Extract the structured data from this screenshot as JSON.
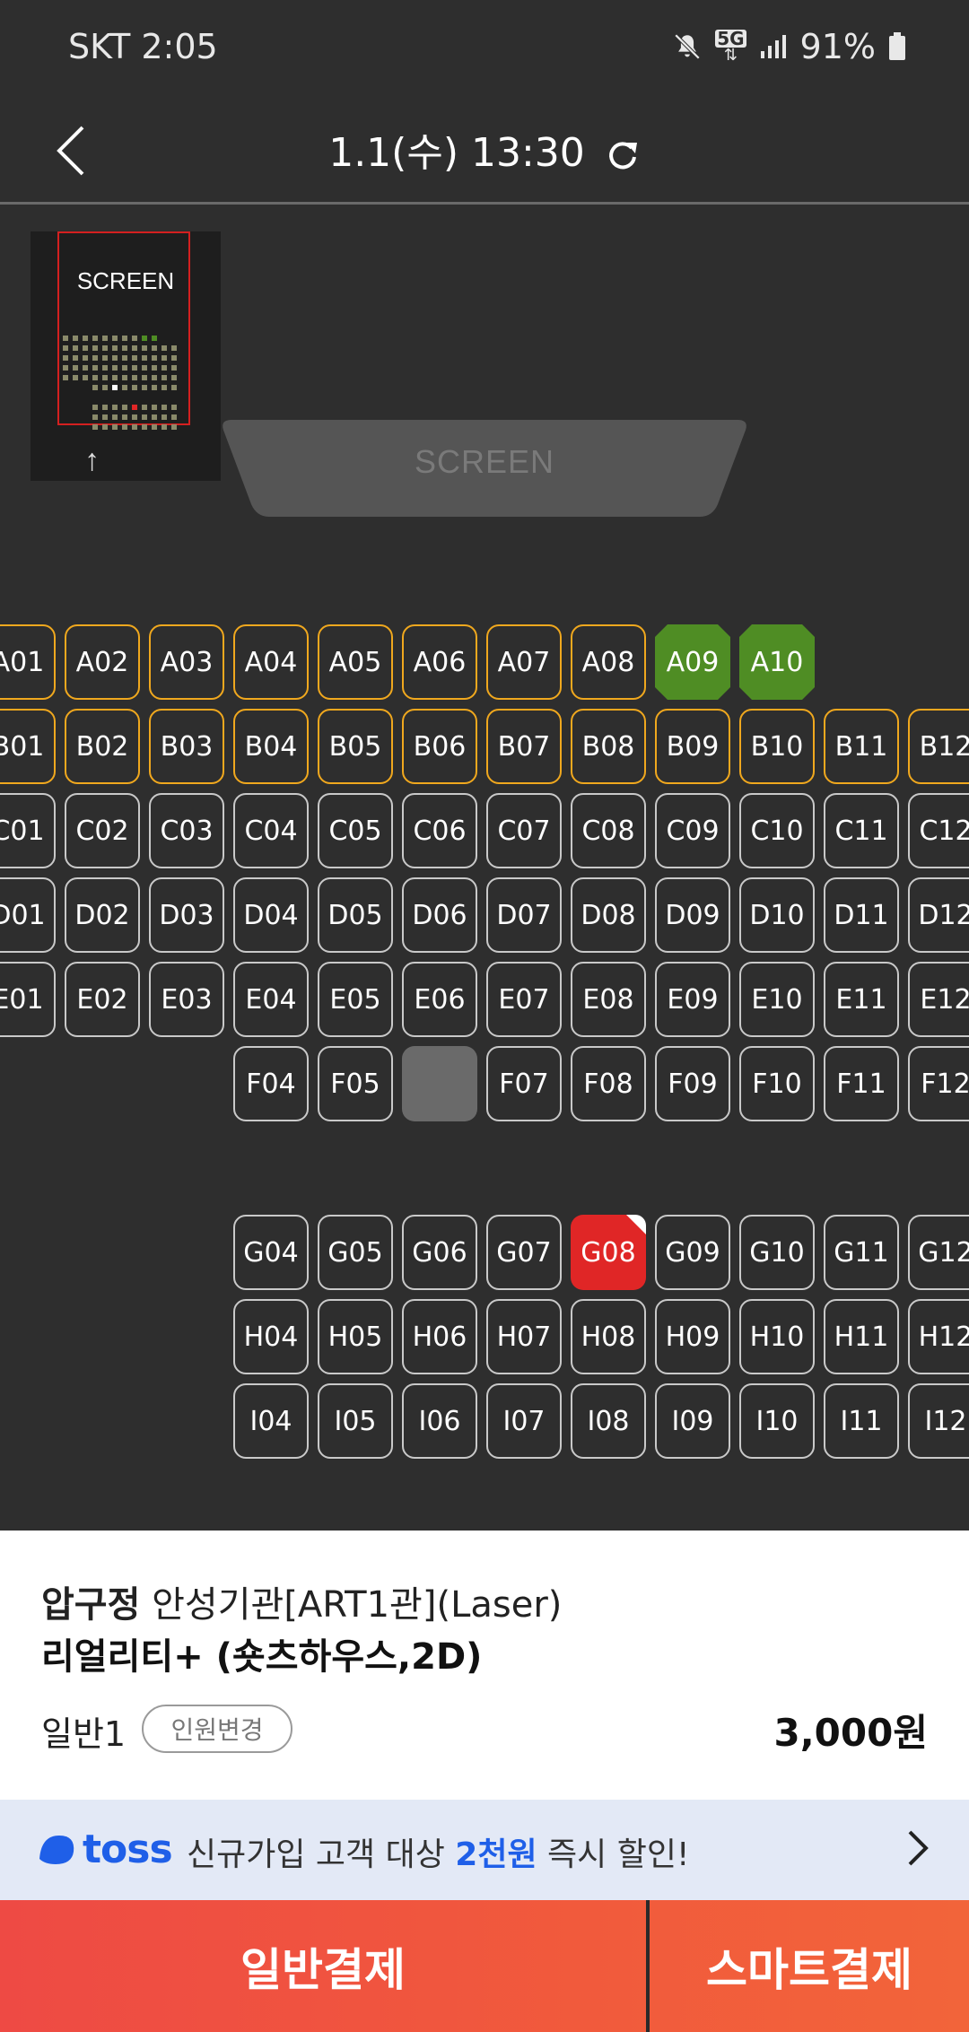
{
  "status_bar": {
    "carrier_time": "SKT 2:05",
    "network": "5G",
    "battery": "91%"
  },
  "header": {
    "title": "1.1(수) 13:30"
  },
  "minimap": {
    "screen_label": "SCREEN"
  },
  "screen": {
    "label": "SCREEN"
  },
  "seats": [
    {
      "id": "A01",
      "row": 0,
      "col": 0,
      "status": "premium"
    },
    {
      "id": "A02",
      "row": 0,
      "col": 1,
      "status": "premium"
    },
    {
      "id": "A03",
      "row": 0,
      "col": 2,
      "status": "premium"
    },
    {
      "id": "A04",
      "row": 0,
      "col": 3,
      "status": "premium"
    },
    {
      "id": "A05",
      "row": 0,
      "col": 4,
      "status": "premium"
    },
    {
      "id": "A06",
      "row": 0,
      "col": 5,
      "status": "premium"
    },
    {
      "id": "A07",
      "row": 0,
      "col": 6,
      "status": "premium"
    },
    {
      "id": "A08",
      "row": 0,
      "col": 7,
      "status": "premium"
    },
    {
      "id": "A09",
      "row": 0,
      "col": 8,
      "status": "selected-green"
    },
    {
      "id": "A10",
      "row": 0,
      "col": 9,
      "status": "selected-green"
    },
    {
      "id": "B01",
      "row": 1,
      "col": 0,
      "status": "premium"
    },
    {
      "id": "B02",
      "row": 1,
      "col": 1,
      "status": "premium"
    },
    {
      "id": "B03",
      "row": 1,
      "col": 2,
      "status": "premium"
    },
    {
      "id": "B04",
      "row": 1,
      "col": 3,
      "status": "premium"
    },
    {
      "id": "B05",
      "row": 1,
      "col": 4,
      "status": "premium"
    },
    {
      "id": "B06",
      "row": 1,
      "col": 5,
      "status": "premium"
    },
    {
      "id": "B07",
      "row": 1,
      "col": 6,
      "status": "premium"
    },
    {
      "id": "B08",
      "row": 1,
      "col": 7,
      "status": "premium"
    },
    {
      "id": "B09",
      "row": 1,
      "col": 8,
      "status": "premium"
    },
    {
      "id": "B10",
      "row": 1,
      "col": 9,
      "status": "premium"
    },
    {
      "id": "B11",
      "row": 1,
      "col": 10,
      "status": "premium"
    },
    {
      "id": "B12",
      "row": 1,
      "col": 11,
      "status": "premium"
    },
    {
      "id": "C01",
      "row": 2,
      "col": 0,
      "status": "normal"
    },
    {
      "id": "C02",
      "row": 2,
      "col": 1,
      "status": "normal"
    },
    {
      "id": "C03",
      "row": 2,
      "col": 2,
      "status": "normal"
    },
    {
      "id": "C04",
      "row": 2,
      "col": 3,
      "status": "normal"
    },
    {
      "id": "C05",
      "row": 2,
      "col": 4,
      "status": "normal"
    },
    {
      "id": "C06",
      "row": 2,
      "col": 5,
      "status": "normal"
    },
    {
      "id": "C07",
      "row": 2,
      "col": 6,
      "status": "normal"
    },
    {
      "id": "C08",
      "row": 2,
      "col": 7,
      "status": "normal"
    },
    {
      "id": "C09",
      "row": 2,
      "col": 8,
      "status": "normal"
    },
    {
      "id": "C10",
      "row": 2,
      "col": 9,
      "status": "normal"
    },
    {
      "id": "C11",
      "row": 2,
      "col": 10,
      "status": "normal"
    },
    {
      "id": "C12",
      "row": 2,
      "col": 11,
      "status": "normal"
    },
    {
      "id": "D01",
      "row": 3,
      "col": 0,
      "status": "normal"
    },
    {
      "id": "D02",
      "row": 3,
      "col": 1,
      "status": "normal"
    },
    {
      "id": "D03",
      "row": 3,
      "col": 2,
      "status": "normal"
    },
    {
      "id": "D04",
      "row": 3,
      "col": 3,
      "status": "normal"
    },
    {
      "id": "D05",
      "row": 3,
      "col": 4,
      "status": "normal"
    },
    {
      "id": "D06",
      "row": 3,
      "col": 5,
      "status": "normal"
    },
    {
      "id": "D07",
      "row": 3,
      "col": 6,
      "status": "normal"
    },
    {
      "id": "D08",
      "row": 3,
      "col": 7,
      "status": "normal"
    },
    {
      "id": "D09",
      "row": 3,
      "col": 8,
      "status": "normal"
    },
    {
      "id": "D10",
      "row": 3,
      "col": 9,
      "status": "normal"
    },
    {
      "id": "D11",
      "row": 3,
      "col": 10,
      "status": "normal"
    },
    {
      "id": "D12",
      "row": 3,
      "col": 11,
      "status": "normal"
    },
    {
      "id": "E01",
      "row": 4,
      "col": 0,
      "status": "normal"
    },
    {
      "id": "E02",
      "row": 4,
      "col": 1,
      "status": "normal"
    },
    {
      "id": "E03",
      "row": 4,
      "col": 2,
      "status": "normal"
    },
    {
      "id": "E04",
      "row": 4,
      "col": 3,
      "status": "normal"
    },
    {
      "id": "E05",
      "row": 4,
      "col": 4,
      "status": "normal"
    },
    {
      "id": "E06",
      "row": 4,
      "col": 5,
      "status": "normal"
    },
    {
      "id": "E07",
      "row": 4,
      "col": 6,
      "status": "normal"
    },
    {
      "id": "E08",
      "row": 4,
      "col": 7,
      "status": "normal"
    },
    {
      "id": "E09",
      "row": 4,
      "col": 8,
      "status": "normal"
    },
    {
      "id": "E10",
      "row": 4,
      "col": 9,
      "status": "normal"
    },
    {
      "id": "E11",
      "row": 4,
      "col": 10,
      "status": "normal"
    },
    {
      "id": "E12",
      "row": 4,
      "col": 11,
      "status": "normal"
    },
    {
      "id": "F04",
      "row": 5,
      "col": 3,
      "status": "normal"
    },
    {
      "id": "F05",
      "row": 5,
      "col": 4,
      "status": "normal"
    },
    {
      "id": "",
      "row": 5,
      "col": 5,
      "status": "blocked"
    },
    {
      "id": "F07",
      "row": 5,
      "col": 6,
      "status": "normal"
    },
    {
      "id": "F08",
      "row": 5,
      "col": 7,
      "status": "normal"
    },
    {
      "id": "F09",
      "row": 5,
      "col": 8,
      "status": "normal"
    },
    {
      "id": "F10",
      "row": 5,
      "col": 9,
      "status": "normal"
    },
    {
      "id": "F11",
      "row": 5,
      "col": 10,
      "status": "normal"
    },
    {
      "id": "F12",
      "row": 5,
      "col": 11,
      "status": "normal"
    },
    {
      "id": "G04",
      "row": 7,
      "col": 3,
      "status": "normal"
    },
    {
      "id": "G05",
      "row": 7,
      "col": 4,
      "status": "normal"
    },
    {
      "id": "G06",
      "row": 7,
      "col": 5,
      "status": "normal"
    },
    {
      "id": "G07",
      "row": 7,
      "col": 6,
      "status": "normal"
    },
    {
      "id": "G08",
      "row": 7,
      "col": 7,
      "status": "taken"
    },
    {
      "id": "G09",
      "row": 7,
      "col": 8,
      "status": "normal"
    },
    {
      "id": "G10",
      "row": 7,
      "col": 9,
      "status": "normal"
    },
    {
      "id": "G11",
      "row": 7,
      "col": 10,
      "status": "normal"
    },
    {
      "id": "G12",
      "row": 7,
      "col": 11,
      "status": "normal"
    },
    {
      "id": "H04",
      "row": 8,
      "col": 3,
      "status": "normal"
    },
    {
      "id": "H05",
      "row": 8,
      "col": 4,
      "status": "normal"
    },
    {
      "id": "H06",
      "row": 8,
      "col": 5,
      "status": "normal"
    },
    {
      "id": "H07",
      "row": 8,
      "col": 6,
      "status": "normal"
    },
    {
      "id": "H08",
      "row": 8,
      "col": 7,
      "status": "normal"
    },
    {
      "id": "H09",
      "row": 8,
      "col": 8,
      "status": "normal"
    },
    {
      "id": "H10",
      "row": 8,
      "col": 9,
      "status": "normal"
    },
    {
      "id": "H11",
      "row": 8,
      "col": 10,
      "status": "normal"
    },
    {
      "id": "H12",
      "row": 8,
      "col": 11,
      "status": "normal"
    },
    {
      "id": "I04",
      "row": 9,
      "col": 3,
      "status": "normal"
    },
    {
      "id": "I05",
      "row": 9,
      "col": 4,
      "status": "normal"
    },
    {
      "id": "I06",
      "row": 9,
      "col": 5,
      "status": "normal"
    },
    {
      "id": "I07",
      "row": 9,
      "col": 6,
      "status": "normal"
    },
    {
      "id": "I08",
      "row": 9,
      "col": 7,
      "status": "normal"
    },
    {
      "id": "I09",
      "row": 9,
      "col": 8,
      "status": "normal"
    },
    {
      "id": "I10",
      "row": 9,
      "col": 9,
      "status": "normal"
    },
    {
      "id": "I11",
      "row": 9,
      "col": 10,
      "status": "normal"
    },
    {
      "id": "I12",
      "row": 9,
      "col": 11,
      "status": "normal"
    }
  ],
  "booking": {
    "location": "압구정",
    "hall": "안성기관[ART1관](Laser)",
    "movie": "리얼리티+ (숏츠하우스,2D)",
    "people": "일반1",
    "change_label": "인원변경",
    "price": "3,000원"
  },
  "toss": {
    "brand": "toss",
    "text_before": "신규가입 고객 대상 ",
    "highlight": "2천원",
    "text_after": " 즉시 할인!"
  },
  "pay": {
    "general": "일반결제",
    "smart": "스마트결제"
  },
  "colors": {
    "premium_border": "#f0a81e",
    "selected": "#4f8d24",
    "taken": "#e02626",
    "accent": "#1f5fe8"
  }
}
